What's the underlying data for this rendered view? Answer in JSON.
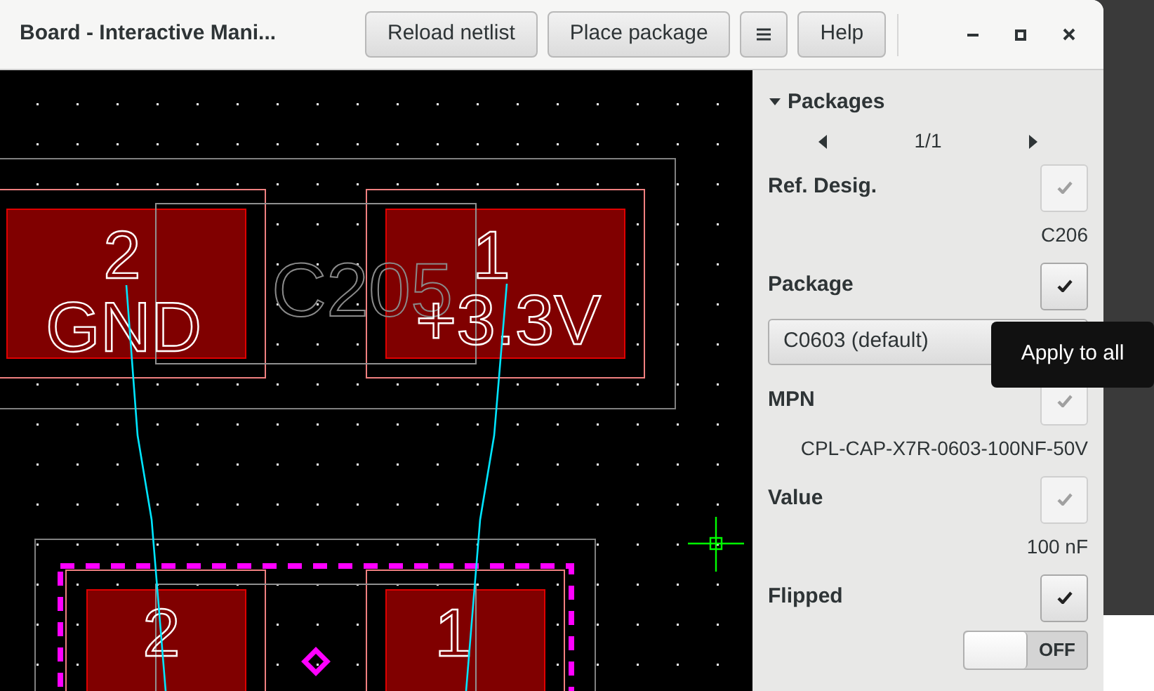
{
  "window": {
    "title": "Board - Interactive Mani...",
    "buttons": [
      {
        "kind": "text",
        "label": "Reload netlist"
      },
      {
        "kind": "text",
        "label": "Place package"
      },
      {
        "kind": "menu"
      },
      {
        "kind": "text",
        "label": "Help"
      }
    ]
  },
  "board": {
    "parts": [
      {
        "ref": "C205",
        "selected": false,
        "pads": [
          {
            "number": "2",
            "net": "GND"
          },
          {
            "number": "1",
            "net": "+3.3V"
          }
        ]
      },
      {
        "selected": true,
        "pads": [
          {
            "number": "2"
          },
          {
            "number": "1"
          }
        ]
      }
    ]
  },
  "sidebar": {
    "section": {
      "title": "Packages",
      "expanded": true
    },
    "pager": "1/1",
    "fields": [
      {
        "kind": "text",
        "label": "Ref. Desig.",
        "value": "C206",
        "apply_disabled": true
      },
      {
        "kind": "dropdown",
        "label": "Package",
        "value": "C0603 (default)",
        "apply_disabled": false
      },
      {
        "kind": "text",
        "label": "MPN",
        "value": "CPL-CAP-X7R-0603-100NF-50V",
        "apply_disabled": true
      },
      {
        "kind": "text",
        "label": "Value",
        "value": "100 nF",
        "apply_disabled": true
      },
      {
        "kind": "switch",
        "label": "Flipped",
        "on": false,
        "switch_label": "OFF",
        "apply_disabled": false
      }
    ]
  },
  "tooltip": {
    "text": "Apply to all"
  }
}
